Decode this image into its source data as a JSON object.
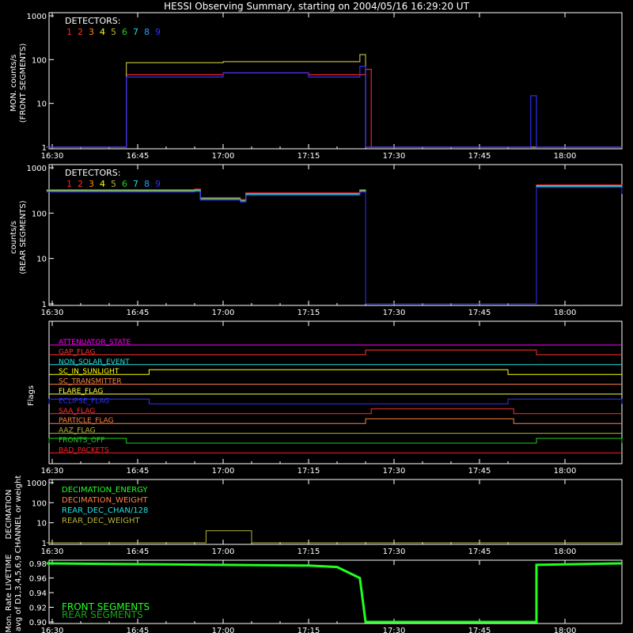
{
  "title": "HESSI Observing Summary, starting on 2004/05/16 16:29:20 UT",
  "colors": {
    "background": "#000000",
    "axis": "#ffffff",
    "detectors": [
      "#ff2020",
      "#ff3030",
      "#ff8c00",
      "#ffff00",
      "#b4b43c",
      "#20d020",
      "#20e0e0",
      "#2aa0ff",
      "#3030ff"
    ]
  },
  "time_axis": {
    "start_minutes": 16.0,
    "end_minutes": 98.0,
    "ticks": [
      {
        "m": 16.0,
        "label": "16:30"
      },
      {
        "m": 31.0,
        "label": "16:45"
      },
      {
        "m": 46.0,
        "label": "17:00"
      },
      {
        "m": 61.0,
        "label": "17:15"
      },
      {
        "m": 76.0,
        "label": "17:30"
      },
      {
        "m": 91.0,
        "label": "17:45"
      },
      {
        "m": 106.0,
        "label": "18:00"
      }
    ]
  },
  "detectors_legend": {
    "title": "DETECTORS:",
    "numbers": [
      "1",
      "2",
      "3",
      "4",
      "5",
      "6",
      "7",
      "8",
      "9"
    ]
  },
  "panel1": {
    "ylabel_line1": "MON. counts/s",
    "ylabel_line2": "(FRONT SEGMENTS)",
    "yticks": [
      "1",
      "10",
      "100",
      "1000"
    ]
  },
  "panel2": {
    "ylabel_line1": "counts/s",
    "ylabel_line2": "(REAR SEGMENTS)",
    "yticks": [
      "1",
      "10",
      "100",
      "1000"
    ]
  },
  "panel3": {
    "ylabel": "Flags",
    "flags": [
      {
        "name": "ATTENUATOR_STATE",
        "color": "#ff00ff"
      },
      {
        "name": "GAP_FLAG",
        "color": "#ff3030"
      },
      {
        "name": "NON_SOLAR_EVENT",
        "color": "#20e0e0"
      },
      {
        "name": "SC_IN_SUNLIGHT",
        "color": "#ffff00"
      },
      {
        "name": "SC_TRANSMITTER",
        "color": "#ff8040"
      },
      {
        "name": "FLARE_FLAG",
        "color": "#ffff40"
      },
      {
        "name": "ECLIPSE_FLAG",
        "color": "#3030ff"
      },
      {
        "name": "SAA_FLAG",
        "color": "#ff3030"
      },
      {
        "name": "PARTICLE_FLAG",
        "color": "#ff8040"
      },
      {
        "name": "AAZ_FLAG",
        "color": "#b4b43c"
      },
      {
        "name": "FRONTS_OFF",
        "color": "#20d020"
      },
      {
        "name": "BAD_PACKETS",
        "color": "#ff2020"
      }
    ]
  },
  "panel4": {
    "ylabel_line1": "DECIMATION",
    "ylabel_line2": "CHANNEL or weight",
    "yticks": [
      "1",
      "10",
      "100",
      "1000"
    ],
    "legend": [
      {
        "name": "DECIMATION_ENERGY",
        "color": "#20ff20"
      },
      {
        "name": "DECIMATION_WEIGHT",
        "color": "#ff8040"
      },
      {
        "name": "REAR_DEC_CHAN/128",
        "color": "#20e0e0"
      },
      {
        "name": "REAR_DEC_WEIGHT",
        "color": "#b4b43c"
      }
    ]
  },
  "panel5": {
    "ylabel_line1": "Mon. Rate LIVETIME",
    "ylabel_line2": "avg of D1,3,4,5,6,9",
    "yticks": [
      "0.90",
      "0.92",
      "0.94",
      "0.96",
      "0.98"
    ],
    "legend": [
      {
        "name": "FRONT SEGMENTS",
        "color": "#20ff20"
      },
      {
        "name": "REAR SEGMENTS",
        "color": "#1aa01a"
      }
    ]
  },
  "chart_data": [
    {
      "type": "line",
      "title": "HESSI Observing Summary, starting on 2004/05/16 16:29:20 UT",
      "ylabel": "MON. counts/s (FRONT SEGMENTS)",
      "yscale": "log",
      "ylim": [
        1,
        1000
      ],
      "x_unit": "UT",
      "series": [
        {
          "name": "1",
          "points": [
            [
              "16:29",
              1
            ],
            [
              "16:42",
              1
            ],
            [
              "16:43",
              45
            ],
            [
              "17:00",
              50
            ],
            [
              "17:15",
              45
            ],
            [
              "17:25",
              60
            ],
            [
              "17:26",
              1
            ],
            [
              "18:10",
              1
            ]
          ]
        },
        {
          "name": "4",
          "points": [
            [
              "16:29",
              1
            ],
            [
              "16:42",
              1
            ],
            [
              "16:43",
              85
            ],
            [
              "17:00",
              90
            ],
            [
              "17:15",
              90
            ],
            [
              "17:24",
              130
            ],
            [
              "17:25",
              1
            ],
            [
              "18:10",
              1
            ]
          ]
        },
        {
          "name": "9",
          "points": [
            [
              "16:29",
              1
            ],
            [
              "16:42",
              1
            ],
            [
              "16:43",
              40
            ],
            [
              "17:00",
              50
            ],
            [
              "17:15",
              40
            ],
            [
              "17:24",
              70
            ],
            [
              "17:25",
              1
            ],
            [
              "17:53",
              1
            ],
            [
              "17:54",
              15
            ],
            [
              "17:55",
              1
            ],
            [
              "18:10",
              1
            ]
          ]
        }
      ]
    },
    {
      "type": "line",
      "ylabel": "counts/s (REAR SEGMENTS)",
      "yscale": "log",
      "ylim": [
        1,
        1000
      ],
      "series": [
        {
          "name": "all",
          "points": [
            [
              "16:29",
              330
            ],
            [
              "16:55",
              340
            ],
            [
              "16:56",
              220
            ],
            [
              "17:03",
              200
            ],
            [
              "17:04",
              280
            ],
            [
              "17:24",
              330
            ],
            [
              "17:25",
              1
            ],
            [
              "17:54",
              1
            ],
            [
              "17:55",
              420
            ],
            [
              "18:10",
              300
            ]
          ]
        }
      ]
    },
    {
      "type": "line",
      "ylabel": "Flags",
      "series": [
        {
          "name": "GAP_FLAG",
          "on": [
            [
              "17:25",
              "17:55"
            ]
          ]
        },
        {
          "name": "SC_IN_SUNLIGHT",
          "on": [
            [
              "16:47",
              "17:50"
            ]
          ]
        },
        {
          "name": "ECLIPSE_FLAG",
          "on": [
            [
              "16:29",
              "16:47"
            ],
            [
              "17:50",
              "18:10"
            ]
          ]
        },
        {
          "name": "SAA_FLAG",
          "on": [
            [
              "17:26",
              "17:51"
            ]
          ]
        },
        {
          "name": "PARTICLE_FLAG",
          "on": [
            [
              "17:25",
              "17:51"
            ]
          ]
        },
        {
          "name": "FRONTS_OFF",
          "on": [
            [
              "16:29",
              "16:43"
            ],
            [
              "17:55",
              "18:10"
            ]
          ]
        }
      ]
    },
    {
      "type": "line",
      "ylabel": "DECIMATION CHANNEL or weight",
      "yscale": "log",
      "ylim": [
        1,
        1000
      ],
      "series": [
        {
          "name": "REAR_DEC_WEIGHT",
          "points": [
            [
              "16:29",
              1
            ],
            [
              "16:57",
              1
            ],
            [
              "16:57",
              4
            ],
            [
              "17:05",
              4
            ],
            [
              "17:05",
              1
            ],
            [
              "18:10",
              1
            ]
          ]
        }
      ]
    },
    {
      "type": "line",
      "ylabel": "Mon. Rate LIVETIME avg of D1,3,4,5,6,9",
      "ylim": [
        0.9,
        0.985
      ],
      "series": [
        {
          "name": "FRONT SEGMENTS",
          "points": [
            [
              "16:29",
              0.98
            ],
            [
              "17:15",
              0.977
            ],
            [
              "17:20",
              0.975
            ],
            [
              "17:24",
              0.96
            ],
            [
              "17:25",
              0.9
            ],
            [
              "17:55",
              0.9
            ],
            [
              "17:55",
              0.978
            ],
            [
              "18:10",
              0.98
            ]
          ]
        }
      ]
    }
  ]
}
